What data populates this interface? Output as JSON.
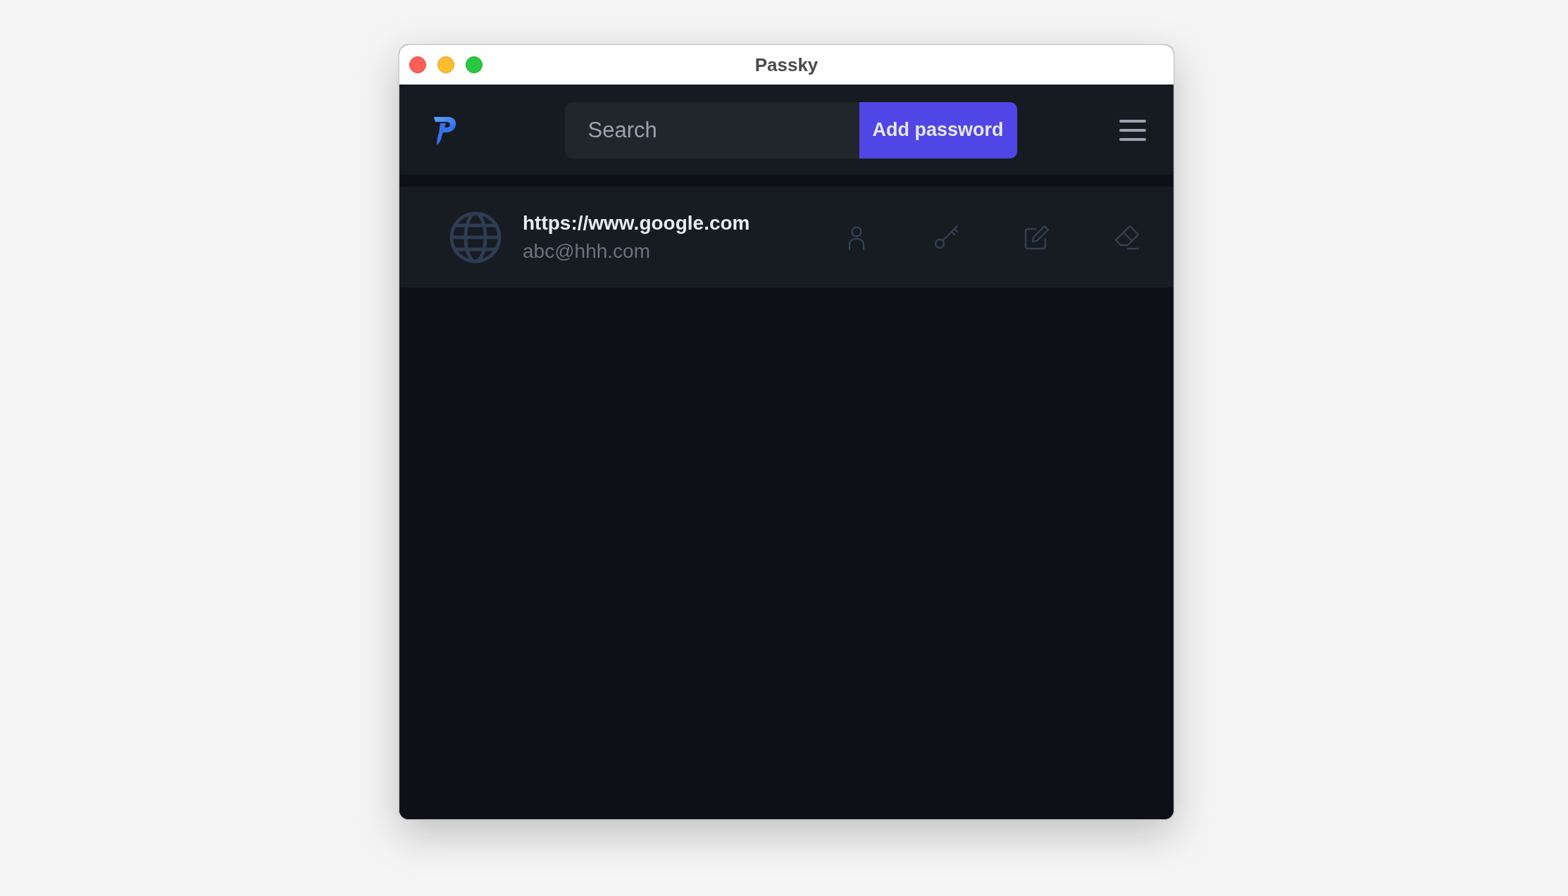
{
  "window": {
    "title": "Passky"
  },
  "header": {
    "search": {
      "placeholder": "Search"
    },
    "add_button": "Add password"
  },
  "passwords": [
    {
      "website": "https://www.google.com",
      "username": "abc@hhh.com"
    }
  ]
}
